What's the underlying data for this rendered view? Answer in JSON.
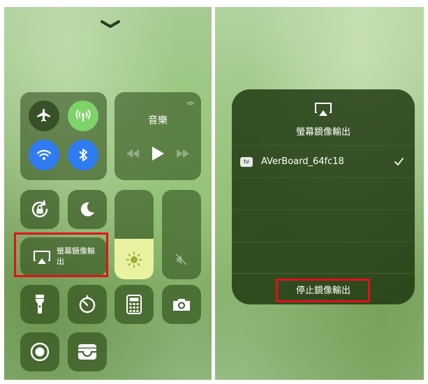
{
  "left": {
    "music_label": "音樂",
    "screen_mirroring_label": "螢幕鏡像輸出"
  },
  "right": {
    "title": "螢幕鏡像輸出",
    "device": {
      "badge": "tv",
      "name": "AVerBoard_64fc18",
      "selected": true
    },
    "stop_button": "停止鏡像輸出"
  },
  "colors": {
    "cellular_active": "#7ed36b",
    "wifi_active": "#2f7bf0",
    "bluetooth_active": "#2f7bf0",
    "brightness_fill": "#e9f2a0",
    "highlight_red": "#e3101b"
  },
  "levels": {
    "brightness": 0.45,
    "volume": 0
  }
}
